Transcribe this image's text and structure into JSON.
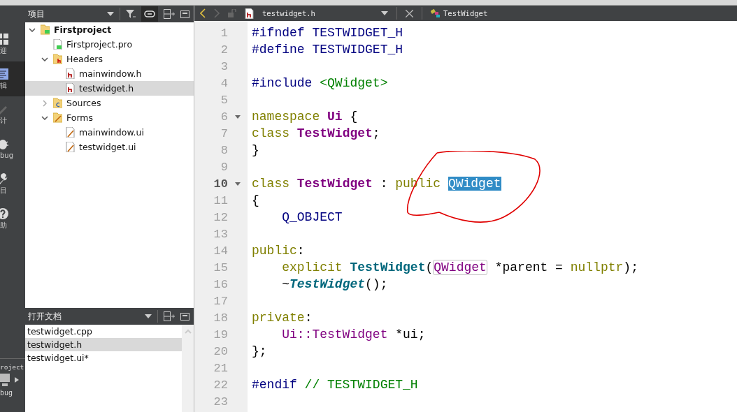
{
  "mode_bar": {
    "items": [
      {
        "label": "迎",
        "kind": "grid",
        "selected": false
      },
      {
        "label": "辑",
        "kind": "edit",
        "selected": true
      },
      {
        "label": "计",
        "kind": "pen",
        "selected": false
      },
      {
        "label": "bug",
        "kind": "bug",
        "selected": false
      },
      {
        "label": "目",
        "kind": "wrench",
        "selected": false
      },
      {
        "label": "助",
        "kind": "help",
        "selected": false
      }
    ],
    "target": {
      "project": "roject",
      "mode": "bug"
    }
  },
  "project_panel": {
    "title": "项目",
    "tree": [
      {
        "label": "Firstproject",
        "kind": "project",
        "expanded": true,
        "selected": false,
        "children": [
          {
            "label": "Firstproject.pro",
            "kind": "pro",
            "selected": false
          },
          {
            "label": "Headers",
            "kind": "folder-h",
            "expanded": true,
            "selected": false,
            "children": [
              {
                "label": "mainwindow.h",
                "kind": "header",
                "selected": false
              },
              {
                "label": "testwidget.h",
                "kind": "header",
                "selected": true
              }
            ]
          },
          {
            "label": "Sources",
            "kind": "folder-cpp",
            "expanded": false,
            "selected": false
          },
          {
            "label": "Forms",
            "kind": "folder-form",
            "expanded": true,
            "selected": false,
            "children": [
              {
                "label": "mainwindow.ui",
                "kind": "form",
                "selected": false
              },
              {
                "label": "testwidget.ui",
                "kind": "form",
                "selected": false
              }
            ]
          }
        ]
      }
    ]
  },
  "open_documents": {
    "title": "打开文档",
    "items": [
      {
        "label": "testwidget.cpp",
        "selected": false
      },
      {
        "label": "testwidget.h",
        "selected": true
      },
      {
        "label": "testwidget.ui*",
        "selected": false
      }
    ]
  },
  "editor": {
    "toolbar": {
      "back_enabled": true,
      "forward_enabled": false,
      "file": "testwidget.h",
      "symbol": "TestWidget"
    },
    "lines": [
      {
        "number": "1",
        "current": false,
        "foldable": false,
        "tokens": [
          {
            "text": "#ifndef",
            "kind": "pre"
          },
          {
            "text": " TESTWIDGET_H",
            "kind": "macro"
          }
        ]
      },
      {
        "number": "2",
        "current": false,
        "foldable": false,
        "tokens": [
          {
            "text": "#define",
            "kind": "pre"
          },
          {
            "text": " TESTWIDGET_H",
            "kind": "macro"
          }
        ]
      },
      {
        "number": "3",
        "current": false,
        "foldable": false
      },
      {
        "number": "4",
        "current": false,
        "foldable": false,
        "tokens": [
          {
            "text": "#include",
            "kind": "pre"
          },
          {
            "text": " <QWidget>",
            "kind": "str"
          }
        ]
      },
      {
        "number": "5",
        "current": false,
        "foldable": false
      },
      {
        "number": "6",
        "current": false,
        "foldable": true,
        "tokens": [
          {
            "text": "namespace",
            "kind": "kw"
          },
          {
            "text": " Ui",
            "kind": "type"
          },
          {
            "text": " {",
            "kind": "plain"
          }
        ]
      },
      {
        "number": "7",
        "current": false,
        "foldable": false,
        "tokens": [
          {
            "text": "class",
            "kind": "kw"
          },
          {
            "text": " TestWidget",
            "kind": "type"
          },
          {
            "text": ";",
            "kind": "plain"
          }
        ]
      },
      {
        "number": "8",
        "current": false,
        "foldable": false,
        "tokens": [
          {
            "text": "}",
            "kind": "plain"
          }
        ]
      },
      {
        "number": "9",
        "current": false,
        "foldable": false
      },
      {
        "number": "10",
        "current": true,
        "foldable": true,
        "tokens": [
          {
            "text": "class",
            "kind": "kw"
          },
          {
            "text": " TestWidget",
            "kind": "type"
          },
          {
            "text": " : ",
            "kind": "plain"
          },
          {
            "text": "public ",
            "kind": "kw"
          },
          {
            "text": "QWidget",
            "kind": "sel"
          }
        ]
      },
      {
        "number": "11",
        "current": false,
        "foldable": false,
        "tokens": [
          {
            "text": "{",
            "kind": "plain"
          }
        ]
      },
      {
        "number": "12",
        "current": false,
        "foldable": false,
        "tokens": [
          {
            "text": "    Q_OBJECT",
            "kind": "macro"
          }
        ]
      },
      {
        "number": "13",
        "current": false,
        "foldable": false
      },
      {
        "number": "14",
        "current": false,
        "foldable": false,
        "tokens": [
          {
            "text": "public",
            "kind": "kw"
          },
          {
            "text": ":",
            "kind": "plain"
          }
        ]
      },
      {
        "number": "15",
        "current": false,
        "foldable": false,
        "tokens": [
          {
            "text": "    explicit",
            "kind": "kw"
          },
          {
            "text": " TestWidget",
            "kind": "func"
          },
          {
            "text": "(",
            "kind": "plain"
          },
          {
            "text": "QWidget",
            "kind": "ref"
          },
          {
            "text": " *parent = ",
            "kind": "plain"
          },
          {
            "text": "nullptr",
            "kind": "kw"
          },
          {
            "text": ");",
            "kind": "plain"
          }
        ]
      },
      {
        "number": "16",
        "current": false,
        "foldable": false,
        "tokens": [
          {
            "text": "    ~",
            "kind": "plain"
          },
          {
            "text": "TestWidget",
            "kind": "func-italic"
          },
          {
            "text": "();",
            "kind": "plain"
          }
        ]
      },
      {
        "number": "17",
        "current": false,
        "foldable": false
      },
      {
        "number": "18",
        "current": false,
        "foldable": false,
        "tokens": [
          {
            "text": "private",
            "kind": "kw"
          },
          {
            "text": ":",
            "kind": "plain"
          }
        ]
      },
      {
        "number": "19",
        "current": false,
        "foldable": false,
        "tokens": [
          {
            "text": "    Ui::TestWidget",
            "kind": "member"
          },
          {
            "text": " *ui;",
            "kind": "plain"
          }
        ]
      },
      {
        "number": "20",
        "current": false,
        "foldable": false,
        "tokens": [
          {
            "text": "};",
            "kind": "plain"
          }
        ]
      },
      {
        "number": "21",
        "current": false,
        "foldable": false
      },
      {
        "number": "22",
        "current": false,
        "foldable": false,
        "tokens": [
          {
            "text": "#endif",
            "kind": "pre"
          },
          {
            "text": " // TESTWIDGET_H",
            "kind": "comment"
          }
        ]
      },
      {
        "number": "23",
        "current": false,
        "foldable": false
      }
    ]
  }
}
